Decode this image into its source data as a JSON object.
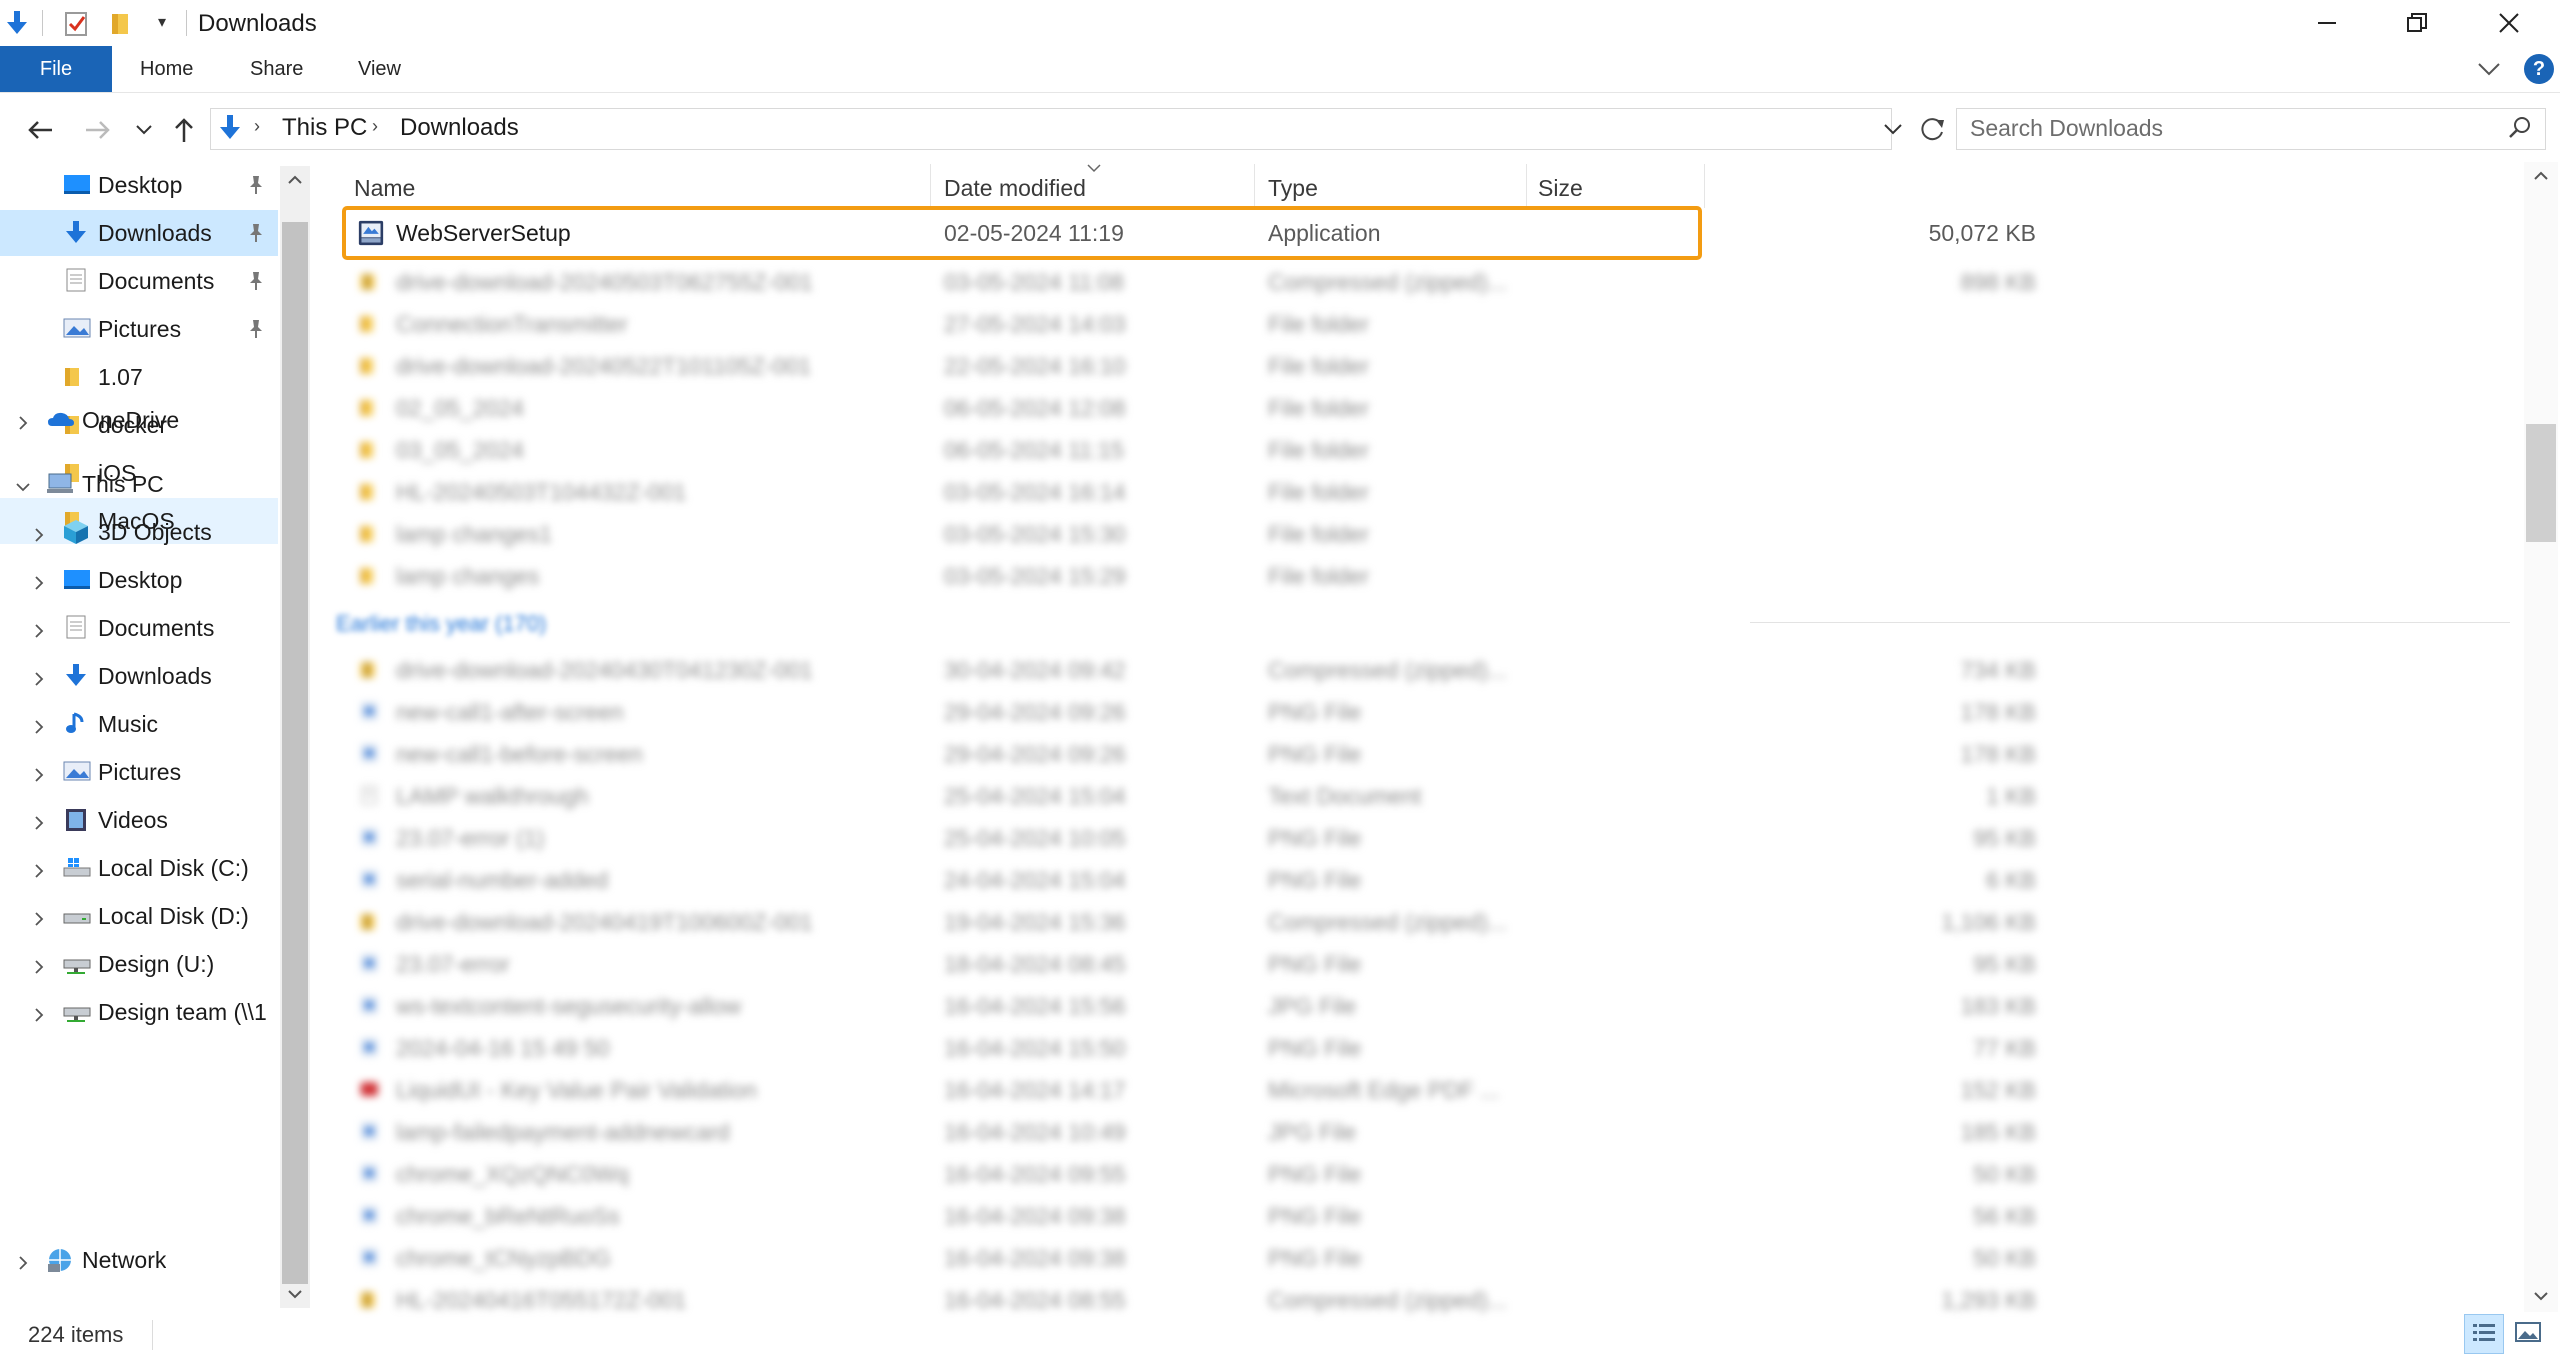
{
  "window": {
    "title": "Downloads",
    "controls": [
      "minimize",
      "maximize",
      "close"
    ]
  },
  "ribbon": {
    "tabs": [
      {
        "label": "File",
        "active": true
      },
      {
        "label": "Home"
      },
      {
        "label": "Share"
      },
      {
        "label": "View"
      }
    ]
  },
  "address": {
    "breadcrumbs": [
      "This PC",
      "Downloads"
    ],
    "search_placeholder": "Search Downloads"
  },
  "navigation": {
    "quick_access": [
      {
        "label": "Desktop",
        "icon": "desktop-icon",
        "pinned": true
      },
      {
        "label": "Downloads",
        "icon": "downloads-icon",
        "pinned": true,
        "selected": true
      },
      {
        "label": "Documents",
        "icon": "documents-icon",
        "pinned": true
      },
      {
        "label": "Pictures",
        "icon": "pictures-icon",
        "pinned": true
      },
      {
        "label": "1.07",
        "icon": "folder-icon"
      },
      {
        "label": "docker",
        "icon": "folder-icon"
      },
      {
        "label": "iOS",
        "icon": "folder-icon"
      },
      {
        "label": "MacOS",
        "icon": "folder-icon",
        "hovered": true
      }
    ],
    "onedrive": {
      "label": "OneDrive",
      "icon": "onedrive-icon"
    },
    "this_pc": {
      "label": "This PC",
      "icon": "computer-icon"
    },
    "this_pc_children": [
      {
        "label": "3D Objects",
        "icon": "3d-objects-icon"
      },
      {
        "label": "Desktop",
        "icon": "desktop-icon"
      },
      {
        "label": "Documents",
        "icon": "documents-icon"
      },
      {
        "label": "Downloads",
        "icon": "downloads-icon"
      },
      {
        "label": "Music",
        "icon": "music-icon"
      },
      {
        "label": "Pictures",
        "icon": "pictures-icon"
      },
      {
        "label": "Videos",
        "icon": "videos-icon"
      },
      {
        "label": "Local Disk (C:)",
        "icon": "windows-drive-icon"
      },
      {
        "label": "Local Disk (D:)",
        "icon": "drive-icon"
      },
      {
        "label": "Design (U:)",
        "icon": "network-drive-icon"
      },
      {
        "label": "Design team (\\\\1",
        "icon": "network-drive-icon"
      }
    ],
    "network": {
      "label": "Network",
      "icon": "network-icon"
    }
  },
  "file_list": {
    "columns": {
      "name": "Name",
      "date": "Date modified",
      "type": "Type",
      "size": "Size"
    },
    "highlighted": {
      "name": "WebServerSetup",
      "date": "02-05-2024 11:19",
      "type": "Application",
      "size": "50,072 KB",
      "icon": "installer-icon"
    },
    "recent_rows": [
      {
        "name": "drive-download-20240503T062755Z-001",
        "date": "03-05-2024 11:08",
        "type": "Compressed (zipped)...",
        "size": "898 KB",
        "icon": "zip-folder-icon"
      },
      {
        "name": "ConnectionTransmitter",
        "date": "27-05-2024 14:03",
        "type": "File folder",
        "size": "",
        "icon": "folder-icon"
      },
      {
        "name": "drive-download-20240522T101105Z-001",
        "date": "22-05-2024 16:10",
        "type": "File folder",
        "size": "",
        "icon": "folder-icon"
      },
      {
        "name": "02_05_2024",
        "date": "06-05-2024 12:08",
        "type": "File folder",
        "size": "",
        "icon": "folder-icon"
      },
      {
        "name": "03_05_2024",
        "date": "06-05-2024 11:15",
        "type": "File folder",
        "size": "",
        "icon": "folder-icon"
      },
      {
        "name": "HL-20240503T104432Z-001",
        "date": "03-05-2024 16:14",
        "type": "File folder",
        "size": "",
        "icon": "folder-icon"
      },
      {
        "name": "lamp changes1",
        "date": "03-05-2024 15:30",
        "type": "File folder",
        "size": "",
        "icon": "folder-icon"
      },
      {
        "name": "lamp changes",
        "date": "03-05-2024 15:29",
        "type": "File folder",
        "size": "",
        "icon": "folder-icon"
      }
    ],
    "group_label": "Earlier this year (170)",
    "earlier_rows": [
      {
        "name": "drive-download-20240430T041230Z-001",
        "date": "30-04-2024 09:42",
        "type": "Compressed (zipped)...",
        "size": "734 KB",
        "icon": "zip-folder-icon"
      },
      {
        "name": "new-call1-after-screen",
        "date": "29-04-2024 09:26",
        "type": "PNG File",
        "size": "178 KB",
        "icon": "image-icon"
      },
      {
        "name": "new-call1-before-screen",
        "date": "29-04-2024 09:26",
        "type": "PNG File",
        "size": "178 KB",
        "icon": "image-icon"
      },
      {
        "name": "LAMP walkthrough",
        "date": "25-04-2024 15:04",
        "type": "Text Document",
        "size": "1 KB",
        "icon": "text-file-icon"
      },
      {
        "name": "23.07-error (1)",
        "date": "25-04-2024 10:05",
        "type": "PNG File",
        "size": "95 KB",
        "icon": "image-icon"
      },
      {
        "name": "serial-number-added",
        "date": "24-04-2024 15:04",
        "type": "PNG File",
        "size": "6 KB",
        "icon": "image-icon"
      },
      {
        "name": "drive-download-20240419T100600Z-001",
        "date": "19-04-2024 15:36",
        "type": "Compressed (zipped)...",
        "size": "1,106 KB",
        "icon": "zip-folder-icon"
      },
      {
        "name": "23.07-error",
        "date": "18-04-2024 08:45",
        "type": "PNG File",
        "size": "95 KB",
        "icon": "image-icon"
      },
      {
        "name": "ws-textcontent-segusecurity-allow",
        "date": "16-04-2024 15:56",
        "type": "JPG File",
        "size": "183 KB",
        "icon": "image-icon"
      },
      {
        "name": "2024-04-16 15 49 50",
        "date": "16-04-2024 15:50",
        "type": "PNG File",
        "size": "77 KB",
        "icon": "image-icon"
      },
      {
        "name": "LiquidUI - Key Value Pair Validation",
        "date": "16-04-2024 14:17",
        "type": "Microsoft Edge PDF ...",
        "size": "152 KB",
        "icon": "pdf-icon"
      },
      {
        "name": "lamp-failedpayment-addnewcard",
        "date": "16-04-2024 10:49",
        "type": "JPG File",
        "size": "185 KB",
        "icon": "image-icon"
      },
      {
        "name": "chrome_XQzQNC0Wq",
        "date": "16-04-2024 09:55",
        "type": "PNG File",
        "size": "50 KB",
        "icon": "image-icon"
      },
      {
        "name": "chrome_bReNtRuoSs",
        "date": "16-04-2024 09:38",
        "type": "PNG File",
        "size": "56 KB",
        "icon": "image-icon"
      },
      {
        "name": "chrome_tCNyzpBDG",
        "date": "16-04-2024 09:38",
        "type": "PNG File",
        "size": "50 KB",
        "icon": "image-icon"
      },
      {
        "name": "HL-20240416T055172Z-001",
        "date": "16-04-2024 08:55",
        "type": "Compressed (zipped)...",
        "size": "1,293 KB",
        "icon": "zip-folder-icon"
      }
    ]
  },
  "status": {
    "item_count": "224 items"
  },
  "colors": {
    "accent": "#1a64b6",
    "highlight": "#f39c12",
    "selection": "#cce8ff"
  }
}
